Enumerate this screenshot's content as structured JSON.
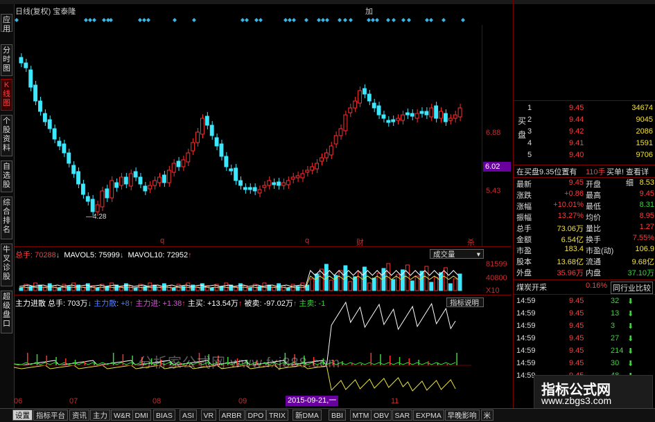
{
  "window": {
    "period_label": "日线(复权)",
    "stock_name": "宝泰隆",
    "top_right_btn": "加"
  },
  "leftnav": [
    {
      "label": "应用",
      "active": false
    },
    {
      "label": "分时图",
      "active": false
    },
    {
      "label": "K线图",
      "active": true
    },
    {
      "label": "个股资料",
      "active": false
    },
    {
      "label": "自选股",
      "active": false
    },
    {
      "label": "综合排名",
      "active": false
    },
    {
      "label": "牛叉诊股",
      "active": false
    },
    {
      "label": "超级盘口",
      "active": false
    }
  ],
  "price_chart": {
    "price_axis": [
      "6.88",
      "6.02",
      "5.43"
    ],
    "current_price_tag": "6.02",
    "low_label": "4.28",
    "markers": [
      "q",
      "q",
      "财",
      "杀"
    ],
    "colors": {
      "up": "#ff3030",
      "down": "#3ce8ff",
      "bg": "#000000"
    }
  },
  "volume_panel": {
    "total_label": "总手: ",
    "total_value": "70288",
    "ma5_label": "MAVOL5: ",
    "ma5_value": "75999",
    "ma10_label": "MAVOL10: ",
    "ma10_value": "72952",
    "dropdown": "成交量",
    "axis": [
      "81599",
      "40800",
      "X10"
    ]
  },
  "indicator_panel": {
    "title": "主力进散 总手: 703万",
    "zl_ye_label": "主力散",
    "zl_ye_value": "+8",
    "zl_jin_label": "主力进",
    "zl_jin_value": "+1.38",
    "zhumai_label": "主买",
    "zhumai_value": "+13.54万",
    "beimai_label": "被卖",
    "beimai_value": "-97.02万",
    "zhumai2_label": "主卖",
    "zhumai2_value": "-1",
    "help_btn": "指标说明",
    "watermark": "分析家公式网 www.fxj888.com"
  },
  "date_axis": {
    "ticks": [
      "06",
      "07",
      "08",
      "09",
      "10",
      "11"
    ],
    "selected_date": "2015-09-21,一"
  },
  "orderbook": {
    "side_label": "买盘",
    "levels": [
      {
        "n": "1",
        "price": "9.45",
        "vol": "34674"
      },
      {
        "n": "2",
        "price": "9.44",
        "vol": "9045"
      },
      {
        "n": "3",
        "price": "9.42",
        "vol": "2086"
      },
      {
        "n": "4",
        "price": "9.41",
        "vol": "1591"
      },
      {
        "n": "5",
        "price": "9.40",
        "vol": "9706"
      }
    ]
  },
  "queue_bar": {
    "text": "在买盘9.35位置有",
    "count": "110手",
    "btn1": "买单!",
    "btn2": "查看详细"
  },
  "quote": [
    {
      "l": "最新",
      "v": "9.45",
      "l2": "开盘",
      "v2": "8.53"
    },
    {
      "l": "涨跌",
      "v": "+0.86",
      "l2": "最高",
      "v2": "9.45"
    },
    {
      "l": "涨幅",
      "v": "+10.01%",
      "l2": "最低",
      "v2": "8.31"
    },
    {
      "l": "振幅",
      "v": "13.27%",
      "l2": "均价",
      "v2": "8.95"
    },
    {
      "l": "总手",
      "v": "73.06万",
      "l2": "量比",
      "v2": "1.27"
    },
    {
      "l": "金额",
      "v": "6.54亿",
      "l2": "换手",
      "v2": "7.55%"
    },
    {
      "l": "市盈",
      "v": "183.4",
      "l2": "市盈(动)",
      "v2": "106.9"
    },
    {
      "l": "股本",
      "v": "13.68亿",
      "l2": "流通",
      "v2": "9.68亿"
    },
    {
      "l": "外盘",
      "v": "35.96万",
      "l2": "内盘",
      "v2": "37.10万"
    }
  ],
  "sector": {
    "name": "煤炭开采",
    "pct": "0.16%",
    "btn": "同行业比较"
  },
  "ticks": [
    {
      "t": "14:59",
      "p": "9.45",
      "v": "32"
    },
    {
      "t": "14:59",
      "p": "9.45",
      "v": "13"
    },
    {
      "t": "14:59",
      "p": "9.45",
      "v": "3"
    },
    {
      "t": "14:59",
      "p": "9.45",
      "v": "27"
    },
    {
      "t": "14:59",
      "p": "9.45",
      "v": "214"
    },
    {
      "t": "14:59",
      "p": "9.45",
      "v": "30"
    },
    {
      "t": "14:59",
      "p": "9.45",
      "v": "48"
    }
  ],
  "logo": {
    "title": "指标公式网",
    "url": "www.zbgs3.com"
  },
  "tabs": [
    "设置",
    "指标平台",
    "资讯",
    "主力",
    "W&R",
    "DMI",
    "BIAS",
    "ASI",
    "VR",
    "ARBR",
    "DPO",
    "TRIX",
    "新DMA",
    "BBI",
    "MTM",
    "OBV",
    "SAR",
    "EXPMA",
    "早晚影响",
    "米"
  ]
}
